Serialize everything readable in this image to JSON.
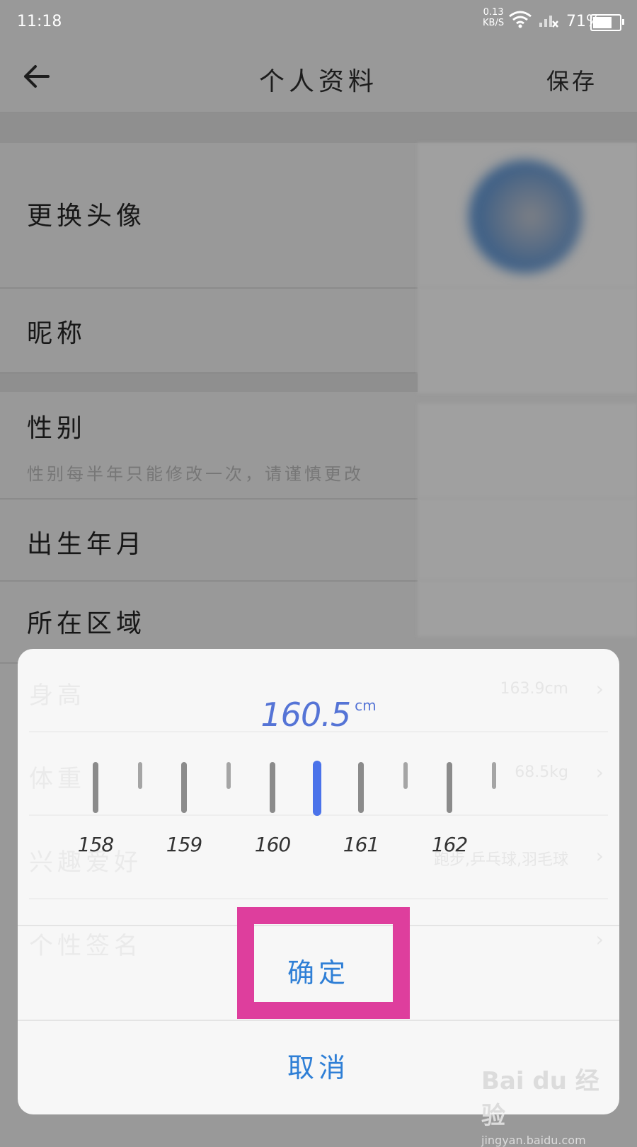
{
  "status_bar": {
    "time": "11:18",
    "net_speed": "0.13",
    "net_unit": "KB/S",
    "battery_pct": "71%",
    "battery_level": 0.71,
    "icons": [
      "wifi-icon",
      "signal-icon",
      "battery-icon"
    ]
  },
  "nav": {
    "title": "个人资料",
    "save_label": "保存",
    "back_icon": "back-arrow-icon"
  },
  "profile_rows": [
    {
      "label": "更换头像"
    },
    {
      "label": "昵称"
    },
    {
      "label": "性别",
      "hint": "性别每半年只能修改一次，请谨慎更改"
    },
    {
      "label": "出生年月"
    },
    {
      "label": "所在区域"
    }
  ],
  "ghost_rows": [
    {
      "label": "身高",
      "value": "163.9cm"
    },
    {
      "label": "体重",
      "value": "68.5kg"
    },
    {
      "label": "兴趣爱好",
      "value": "跑步,乒乓球,羽毛球"
    },
    {
      "label": "个性签名",
      "value": ""
    }
  ],
  "picker": {
    "value": "160.5",
    "unit": "cm",
    "tick_labels": [
      "158",
      "159",
      "160",
      "161",
      "162"
    ],
    "selected_value": 160.5,
    "confirm_label": "确定",
    "cancel_label": "取消"
  },
  "colors": {
    "accent": "#4b73ea",
    "button_text": "#2f7fd6",
    "highlight": "#de3e9d"
  },
  "watermark": {
    "logo": "Bai du 经验",
    "url": "jingyan.baidu.com"
  }
}
